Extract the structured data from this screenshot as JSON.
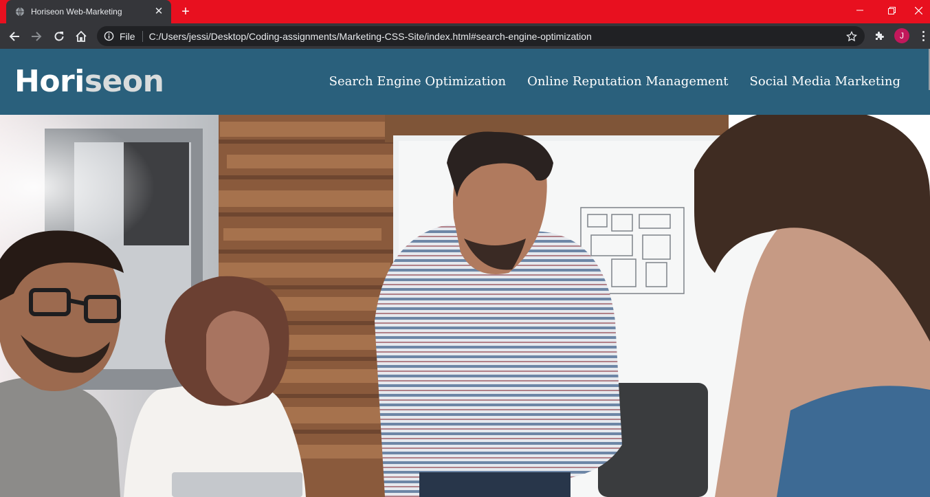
{
  "browser": {
    "tab_title": "Horiseon Web-Marketing",
    "address_scheme": "File",
    "address_url": "C:/Users/jessi/Desktop/Coding-assignments/Marketing-CSS-Site/index.html#search-engine-optimization",
    "profile_initial": "J",
    "colors": {
      "tabstrip": "#e8101f",
      "toolbar": "#35363a",
      "omnibox": "#202124",
      "avatar": "#c2185b"
    }
  },
  "site": {
    "logo_main": "Hori",
    "logo_accent": "seon",
    "nav": [
      "Search Engine Optimization",
      "Online Reputation Management",
      "Social Media Marketing"
    ],
    "colors": {
      "header_bg": "#2a607c",
      "logo_accent": "#d9dcdc"
    },
    "hero_image": "team-meeting-photo"
  }
}
